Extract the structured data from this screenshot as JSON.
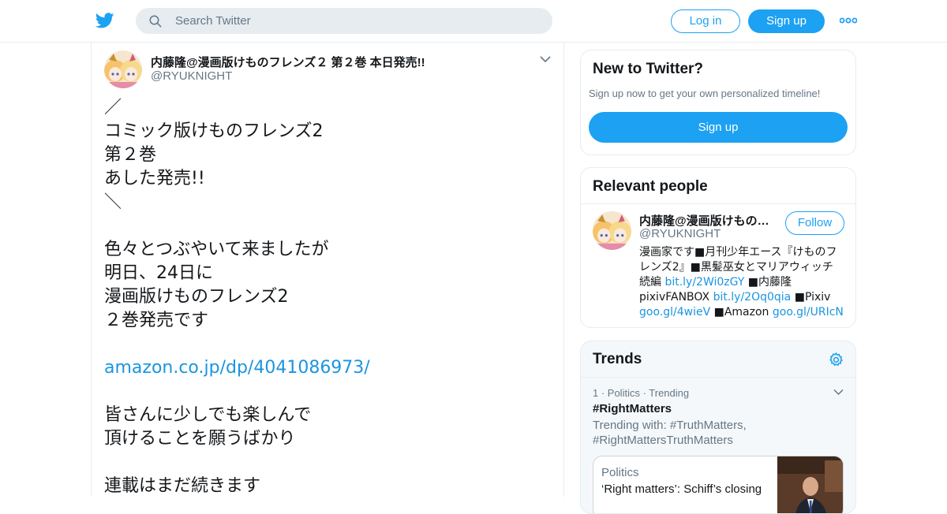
{
  "header": {
    "search_placeholder": "Search Twitter",
    "login_label": "Log in",
    "signup_label": "Sign up",
    "brand_color": "#1da1f2",
    "icons": [
      "twitter-bird-icon",
      "search-icon",
      "more-icon"
    ]
  },
  "tweet": {
    "author_name": "内藤隆@漫画版けものフレンズ２ 第２巻 本日発売!!",
    "author_handle": "@RYUKNIGHT",
    "lines": [
      "／",
      "コミック版けものフレンズ2",
      "第２巻",
      "あした発売!!",
      "＼",
      "",
      "色々とつぶやいて来ましたが",
      "明日、24日に",
      "漫画版けものフレンズ2",
      "２巻発売です",
      "",
      "amazon.co.jp/dp/4041086973/",
      "",
      "皆さんに少しでも楽しんで",
      "頂けることを願うばかり",
      "",
      "連載はまだ続きます"
    ],
    "link_line_index": 11
  },
  "new_to_twitter": {
    "title": "New to Twitter?",
    "subtitle": "Sign up now to get your own personalized timeline!",
    "signup_label": "Sign up"
  },
  "relevant_people": {
    "title": "Relevant people",
    "name": "内藤隆@漫画版けもの…",
    "handle": "@RYUKNIGHT",
    "follow_label": "Follow",
    "bio_text_1": "漫画家です■月刊少年エース『けものフレンズ2』■黒髪巫女とマリアウィッチ 続編 ",
    "bio_link_1": "bit.ly/2Wi0zGY",
    "bio_text_2": " ■内藤隆 pixivFANBOX ",
    "bio_link_2": "bit.ly/2Oq0qia",
    "bio_text_3": " ■Pixiv ",
    "bio_link_3": "goo.gl/4wieV",
    "bio_text_4": " ■Amazon ",
    "bio_link_4": "goo.gl/URIcN"
  },
  "trends": {
    "title": "Trends",
    "item": {
      "meta": "1 · Politics · Trending",
      "tag": "#RightMatters",
      "with": "Trending with: #TruthMatters, #RightMattersTruthMatters"
    },
    "news": {
      "category": "Politics",
      "headline": "‘Right matters’: Schiff’s closing"
    }
  }
}
